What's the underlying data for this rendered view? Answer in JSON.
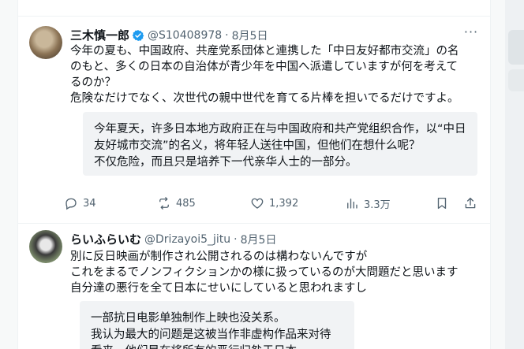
{
  "tweets": [
    {
      "author": "三木慎一郎",
      "handle": "@S10408978",
      "separator": "·",
      "date": "8月5日",
      "more_label": "···",
      "text": "今年の夏も、中国政府、共産党系団体と連携した「中日友好都市交流」の名\nのもと、多くの日本の自治体が青少年を中国へ派遣していますが何を考えて\nるのか？\n危険なだけでなく、次世代の親中世代を育てる片棒を担いでるだけですよ。",
      "translation": "今年夏天，许多日本地方政府正在与中国政府和共产党组织合作，以“中日\n友好城市交流”的名义，将年轻人送往中国，但他们在想什么呢？\n不仅危险，而且只是培养下一代亲华人士的一部分。",
      "stats": {
        "replies": "34",
        "retweets": "485",
        "likes": "1,392",
        "views": "3.3万"
      }
    },
    {
      "author": "らいふらいむ",
      "handle": "@Drizayoi5_jitu",
      "separator": "·",
      "date": "8月5日",
      "text": "別に反日映画が制作され公開されるのは構わないんですが\nこれをまるでノンフィクションかの様に扱っているのが大問題だと思います\n自分達の悪行を全て日本にせいにしていると思われますし",
      "translation": "一部抗日电影单独制作上映也没关系。\n我认为最大的问题是这被当作非虚构作品来对待\n看来，他们是在将所有的恶行归咎于日本"
    }
  ],
  "colors": {
    "verified": "#1d9bf0",
    "muted": "#536471",
    "translation_bg": "#f1f3f5"
  }
}
